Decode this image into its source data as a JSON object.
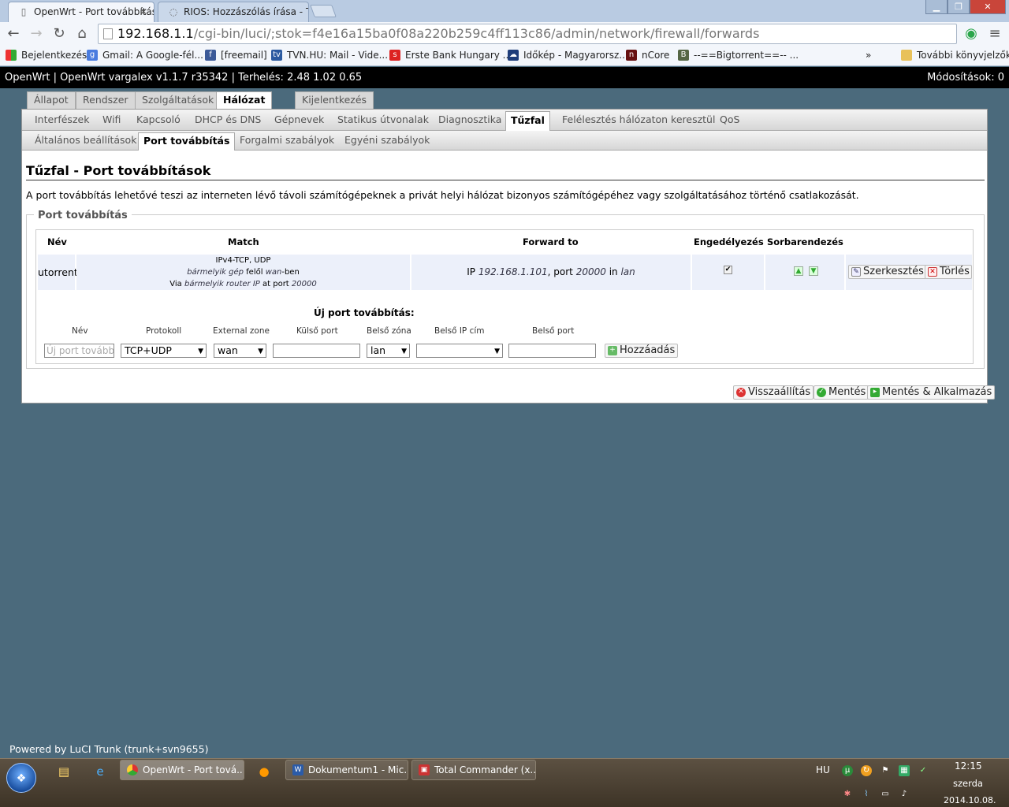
{
  "browser": {
    "tabs": [
      {
        "label": "OpenWrt - Port továbbítás"
      },
      {
        "label": "RIOS: Hozzászólás írása - T"
      }
    ],
    "url_host": "192.168.1.1",
    "url_path": "/cgi-bin/luci/;stok=f4e16a15ba0f08a220b259c4ff113c86/admin/network/firewall/forwards",
    "bookmarks": [
      {
        "label": "Bejelentkezés"
      },
      {
        "label": "Gmail: A Google-fél..."
      },
      {
        "label": "[freemail]"
      },
      {
        "label": "TVN.HU: Mail - Vide..."
      },
      {
        "label": "Erste Bank Hungary ..."
      },
      {
        "label": "Időkép - Magyarorsz..."
      },
      {
        "label": "nCore"
      },
      {
        "label": "--==Bigtorrent==-- ..."
      }
    ],
    "bookmarks_more": "»",
    "other_bookmarks": "További könyvjelzők"
  },
  "header": {
    "left": "OpenWrt | OpenWrt vargalex v1.1.7 r35342 | Terhelés: 2.48 1.02 0.65",
    "right": "Módosítások: 0"
  },
  "main_tabs": [
    "Állapot",
    "Rendszer",
    "Szolgáltatások",
    "Hálózat",
    "Kijelentkezés"
  ],
  "sub_tabs": [
    "Interfészek",
    "Wifi",
    "Kapcsoló",
    "DHCP és DNS",
    "Gépnevek",
    "Statikus útvonalak",
    "Diagnosztika",
    "Tűzfal",
    "Felélesztés hálózaton keresztül",
    "QoS"
  ],
  "sub_tabs2": [
    "Általános beállítások",
    "Port továbbítás",
    "Forgalmi szabályok",
    "Egyéni szabályok"
  ],
  "page": {
    "title": "Tűzfal - Port továbbítások",
    "description": "A port továbbítás lehetővé teszi az interneten lévő távoli számítógépeknek a privát helyi hálózat bizonyos számítógépéhez vagy szolgáltatásához történő csatlakozását.",
    "section_title": "Port továbbítás"
  },
  "table": {
    "headers": [
      "Név",
      "Match",
      "Forward to",
      "Engedélyezés",
      "Sorbarendezés"
    ],
    "row": {
      "name": "utorrent",
      "match_line1": "IPv4-TCP, UDP",
      "match_l2_a": "bármelyik gép",
      "match_l2_b": " felől ",
      "match_l2_c": "wan",
      "match_l2_d": "-ben",
      "match_l3_a": "Via ",
      "match_l3_b": "bármelyik router IP",
      "match_l3_c": " at port ",
      "match_l3_d": "20000",
      "fwd_a": "IP ",
      "fwd_b": "192.168.1.101",
      "fwd_c": ", port ",
      "fwd_d": "20000",
      "fwd_e": " in ",
      "fwd_f": "lan",
      "edit": "Szerkesztés",
      "delete": "Törlés"
    }
  },
  "new_forward": {
    "title": "Új port továbbítás:",
    "labels": [
      "Név",
      "Protokoll",
      "External zone",
      "Külső port",
      "Belső zóna",
      "Belső IP cím",
      "Belső port"
    ],
    "name_placeholder": "Új port továbbítás",
    "protocol": "TCP+UDP",
    "external_zone": "wan",
    "internal_zone": "lan",
    "add_label": "Hozzáadás"
  },
  "actions": {
    "reset": "Visszaállítás",
    "save": "Mentés",
    "save_apply": "Mentés & Alkalmazás"
  },
  "footer": "Powered by LuCI Trunk (trunk+svn9655)",
  "taskbar": {
    "buttons": [
      "OpenWrt - Port tová...",
      "Dokumentum1 - Mic...",
      "Total Commander (x..."
    ],
    "lang": "HU",
    "time": "12:15",
    "day": "szerda",
    "date": "2014.10.08."
  }
}
